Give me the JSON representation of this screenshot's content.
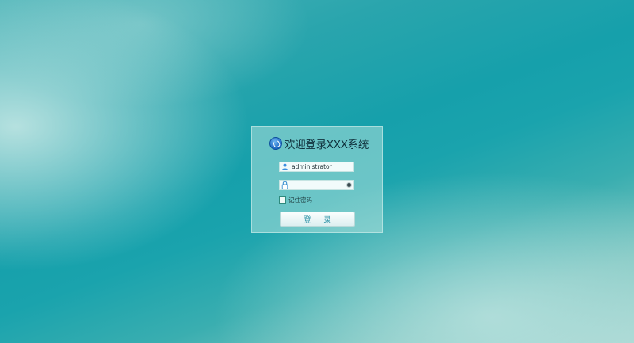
{
  "login": {
    "title": "欢迎登录XXX系统",
    "username": {
      "value": "administrator",
      "icon": "user-icon"
    },
    "password": {
      "value": "",
      "icon": "lock-icon",
      "toggle_icon": "eye-icon"
    },
    "remember": {
      "label": "记住密码",
      "checked": false
    },
    "submit_label": "登 录"
  },
  "colors": {
    "background": "#1aa3ad",
    "panel": "#afe1dc",
    "button_text": "#2f94a8",
    "logo": "#1b66c2"
  }
}
